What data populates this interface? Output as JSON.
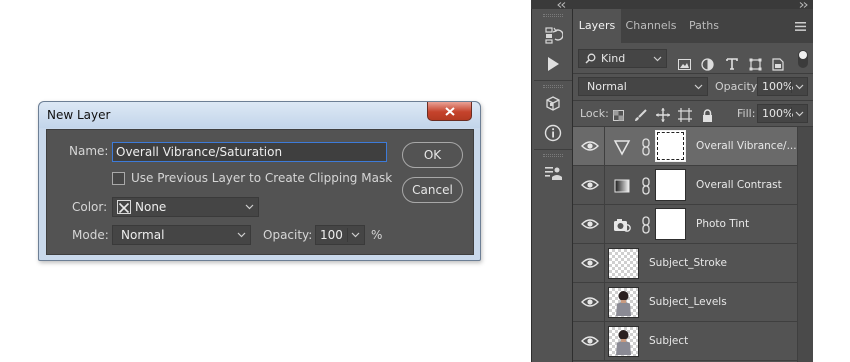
{
  "dialog": {
    "title": "New Layer",
    "name_label": "Name:",
    "name_value": "Overall Vibrance/Saturation",
    "clipping_label": "Use Previous Layer to Create Clipping Mask",
    "clipping_checked": false,
    "color_label": "Color:",
    "color_value": "None",
    "mode_label": "Mode:",
    "mode_value": "Normal",
    "opacity_label": "Opacity:",
    "opacity_value": "100",
    "opacity_unit": "%",
    "ok_label": "OK",
    "cancel_label": "Cancel"
  },
  "panel": {
    "tabs": [
      {
        "label": "Layers",
        "active": true
      },
      {
        "label": "Channels",
        "active": false
      },
      {
        "label": "Paths",
        "active": false
      }
    ],
    "filter": {
      "kind_label": "Kind"
    },
    "blend_mode": "Normal",
    "opacity_label": "Opacity:",
    "opacity_value": "100%",
    "lock_label": "Lock:",
    "fill_label": "Fill:",
    "fill_value": "100%",
    "layers": [
      {
        "name": "Overall Vibrance/...",
        "type": "adjustment",
        "icon": "vibrance-icon",
        "selected": true
      },
      {
        "name": "Overall Contrast",
        "type": "adjustment",
        "icon": "gradient-map-icon",
        "selected": false
      },
      {
        "name": "Photo Tint",
        "type": "adjustment",
        "icon": "photo-filter-icon",
        "selected": false
      },
      {
        "name": "Subject_Stroke",
        "type": "pixel",
        "selected": false
      },
      {
        "name": "Subject_Levels",
        "type": "pixel",
        "selected": false
      },
      {
        "name": "Subject",
        "type": "pixel",
        "selected": false
      }
    ]
  },
  "colors": {
    "dialog_frame": "#c9d9ec",
    "dialog_body": "#535353",
    "panel_bg": "#535353",
    "selected_row": "#6a6a6a",
    "focus_border": "#3d7bd9",
    "close_button": "#c5432c"
  }
}
